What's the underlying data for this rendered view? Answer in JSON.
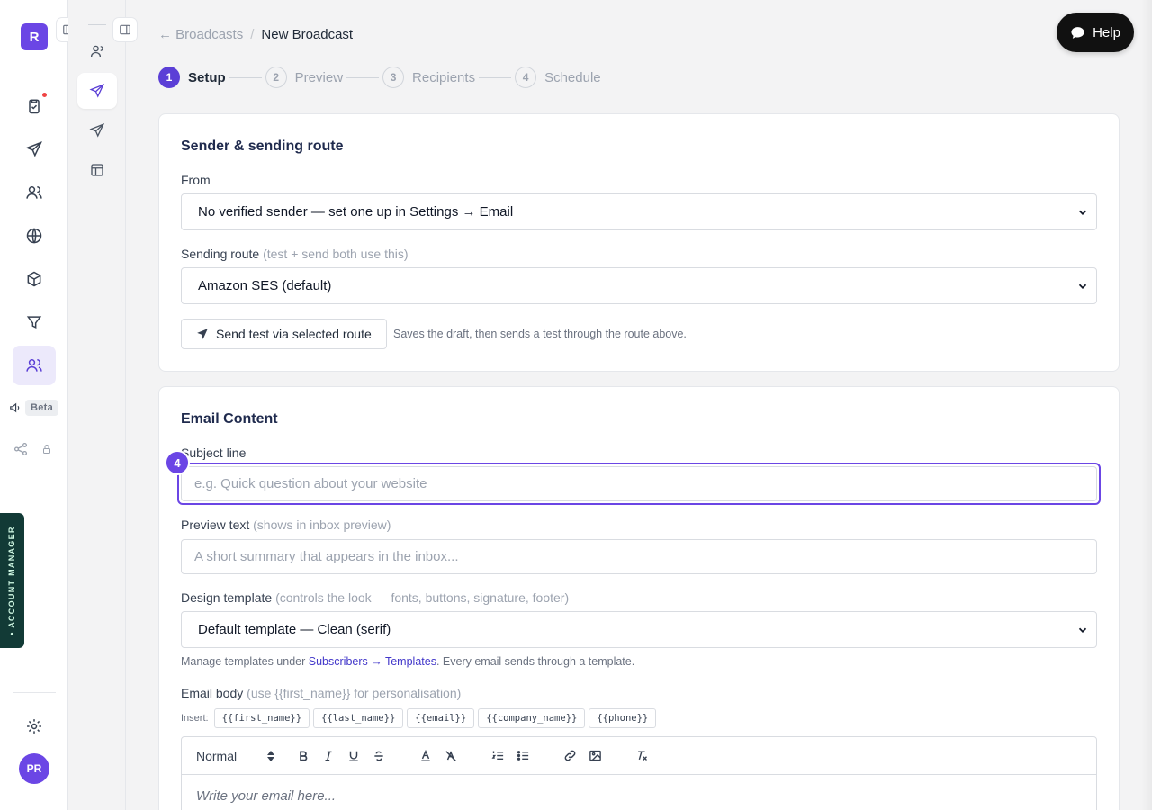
{
  "rail": {
    "logo_letter": "R",
    "beta_label": "Beta",
    "account_manager": "• ACCOUNT MANAGER",
    "avatar_initials": "PR"
  },
  "breadcrumb": {
    "back": "← Broadcasts",
    "separator": "/",
    "current": "New Broadcast"
  },
  "help": {
    "label": "Help"
  },
  "stepper": {
    "steps": [
      {
        "num": "1",
        "label": "Setup",
        "active": true
      },
      {
        "num": "2",
        "label": "Preview",
        "active": false
      },
      {
        "num": "3",
        "label": "Recipients",
        "active": false
      },
      {
        "num": "4",
        "label": "Schedule",
        "active": false
      }
    ]
  },
  "sender": {
    "title": "Sender & sending route",
    "from_label": "From",
    "from_value": "No verified sender — set one up in Settings → Email",
    "route_label": "Sending route",
    "route_hint": "(test + send both use this)",
    "route_value": "Amazon SES (default)",
    "test_button": "Send test via selected route",
    "test_note": "Saves the draft, then sends a test through the route above."
  },
  "content": {
    "title": "Email Content",
    "tour_badge": "4",
    "subject_label": "Subject line",
    "subject_placeholder": "e.g. Quick question about your website",
    "preview_label": "Preview text",
    "preview_hint": "(shows in inbox preview)",
    "preview_placeholder": "A short summary that appears in the inbox...",
    "template_label": "Design template",
    "template_hint": "(controls the look — fonts, buttons, signature, footer)",
    "template_value": "Default template — Clean (serif)",
    "manage_prefix": "Manage templates under ",
    "manage_link": "Subscribers → Templates",
    "manage_suffix": ". Every email sends through a template.",
    "body_label": "Email body",
    "body_hint": "(use {{first_name}} for personalisation)",
    "insert_label": "Insert:",
    "merge_tags": [
      "{{first_name}}",
      "{{last_name}}",
      "{{email}}",
      "{{company_name}}",
      "{{phone}}"
    ],
    "toolbar_format": "Normal",
    "editor_placeholder": "Write your email here..."
  },
  "colors": {
    "accent": "#6b46e5",
    "help_bg": "#111111",
    "account_tab": "#123a36"
  }
}
